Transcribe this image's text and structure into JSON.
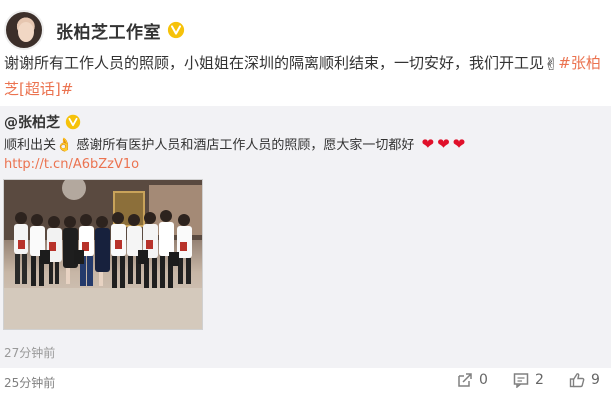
{
  "post": {
    "author": "张柏芝工作室",
    "text_before_emoji": "谢谢所有工作人员的照顾，小姐姐在深圳的隔离顺利结束，一切安好，我们开工见",
    "emoji": "✌",
    "topic": "#张柏芝[超话]#"
  },
  "repost": {
    "author": "@张柏芝",
    "text_prefix": "顺利出关",
    "emoji": "👌",
    "text": "感谢所有医护人员和酒店工作人员的照顾，愿大家一切都好",
    "hearts": [
      "❤",
      "❤",
      "❤"
    ],
    "link": "http://t.cn/A6bZzV1o",
    "time": "27分钟前"
  },
  "footer": {
    "time": "25分钟前",
    "share_count": "0",
    "comment_count": "2",
    "like_count": "9"
  },
  "colors": {
    "accent": "#eb7350",
    "verified": "#f6c20a",
    "heart": "#e0102a"
  }
}
